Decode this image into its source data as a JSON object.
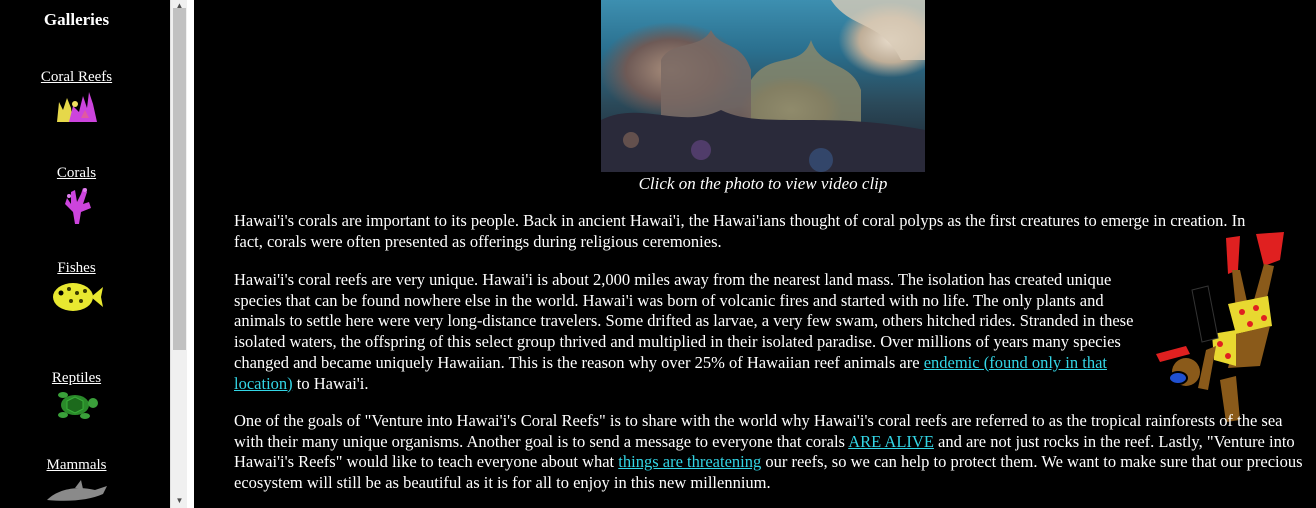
{
  "sidebar": {
    "title": "Galleries",
    "items": [
      {
        "label": "Coral Reefs",
        "icon": "coral-reef-icon"
      },
      {
        "label": "Corals",
        "icon": "coral-icon"
      },
      {
        "label": "Fishes",
        "icon": "fish-icon"
      },
      {
        "label": "Reptiles",
        "icon": "turtle-icon"
      },
      {
        "label": "Mammals",
        "icon": "dolphin-icon"
      }
    ]
  },
  "main": {
    "caption": "Click on the photo to view video clip",
    "para1": "Hawai'i's corals are important to its people. Back in ancient Hawai'i, the Hawai'ians thought of coral polyps as the first creatures to emerge in creation. In fact, corals were often presented as offerings during religious ceremonies.",
    "para2_text": "Hawai'i's coral reefs are very unique. Hawai'i is about 2,000 miles away from the nearest land mass. The isolation has created unique species that can be found nowhere else in the world. Hawai'i was born of volcanic fires and started with no life. The only plants and animals to settle here were very long-distance travelers. Some drifted as larvae, a very few swam, others hitched rides. Stranded in these isolated waters, the offspring of this select group thrived and multiplied in their isolated paradise. Over millions of years many species changed and became uniquely Hawaiian. This is the reason why over 25% of Hawaiian reef animals are ",
    "para2_link": "endemic (found only in that location)",
    "para2_end": " to Hawai'i.",
    "para3_a": "One of the goals of \"Venture into Hawai'i's Coral Reefs\" is to share with the world why Hawai'i's coral reefs are referred to as the tropical rainforests of the sea with their many unique organisms. Another goal is to send a message to everyone that corals ",
    "para3_link1": "ARE ALIVE",
    "para3_b": " and are not just rocks in the reef. Lastly, \"Venture into Hawai'i's Reefs\" would like to teach everyone about what ",
    "para3_link2": "things are threatening",
    "para3_c": " our reefs, so we can help to protect them. We want to make sure that our precious ecosystem will still be as beautiful as it is for all to enjoy in this new millennium."
  },
  "colors": {
    "link": "#33d6e6",
    "background": "#000000",
    "text": "#ffffff"
  }
}
